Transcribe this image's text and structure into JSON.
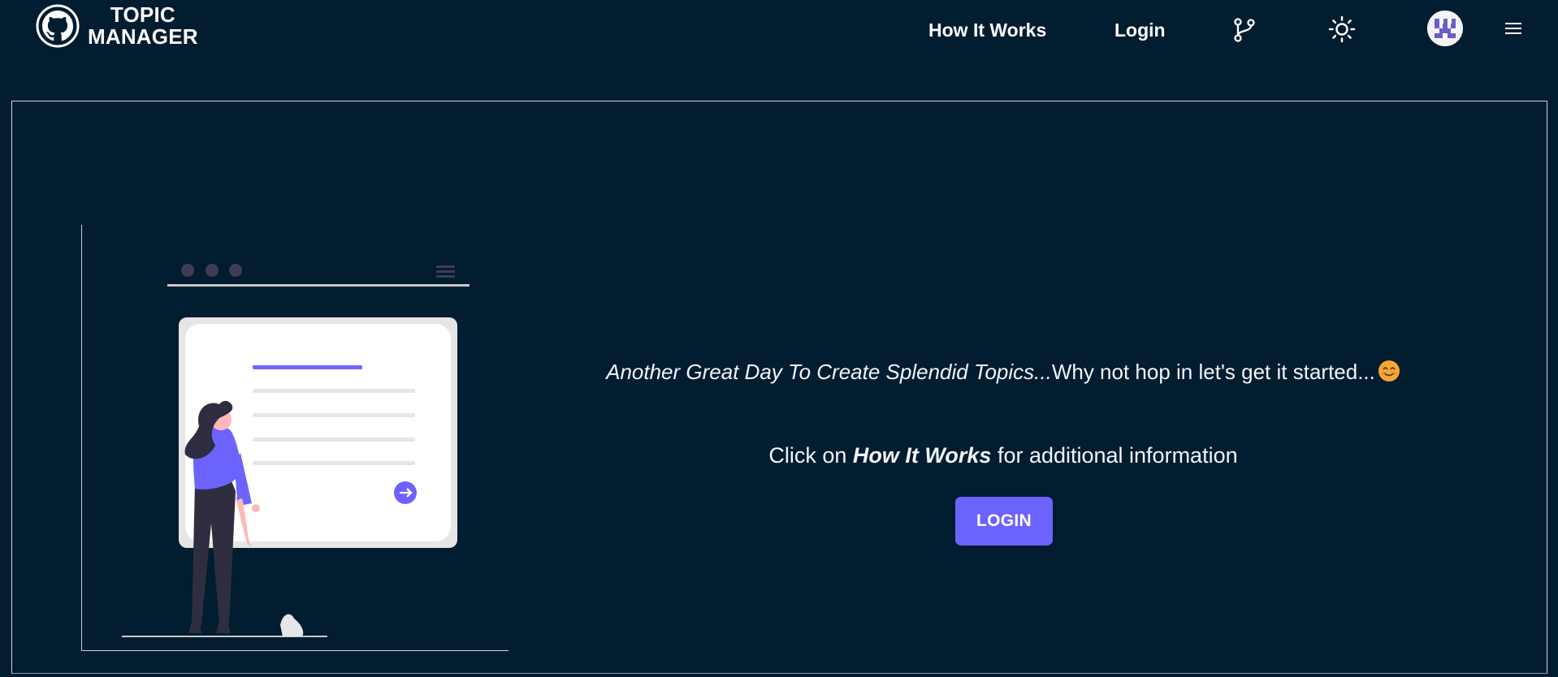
{
  "navbar": {
    "brand_line1": "TOPIC",
    "brand_line2": "MANAGER",
    "links": {
      "how_it_works": "How It Works",
      "login": "Login"
    },
    "icons": {
      "logo": "github-icon",
      "source": "git-branch-icon",
      "theme": "sun-icon",
      "avatar": "avatar-identicon",
      "menu": "hamburger-menu-icon"
    }
  },
  "hero": {
    "tagline_italic": "Another Great Day To Create Splendid Topics...",
    "tagline_rest": "Why not hop in let's get it started...",
    "tagline_emoji": "smiling-face-emoji",
    "info_prefix": "Click on ",
    "info_emphasis": "How It Works",
    "info_suffix": " for additional information",
    "login_button": "LOGIN"
  },
  "colors": {
    "background": "#021c30",
    "accent": "#6c63ff",
    "text": "#ffffff"
  }
}
